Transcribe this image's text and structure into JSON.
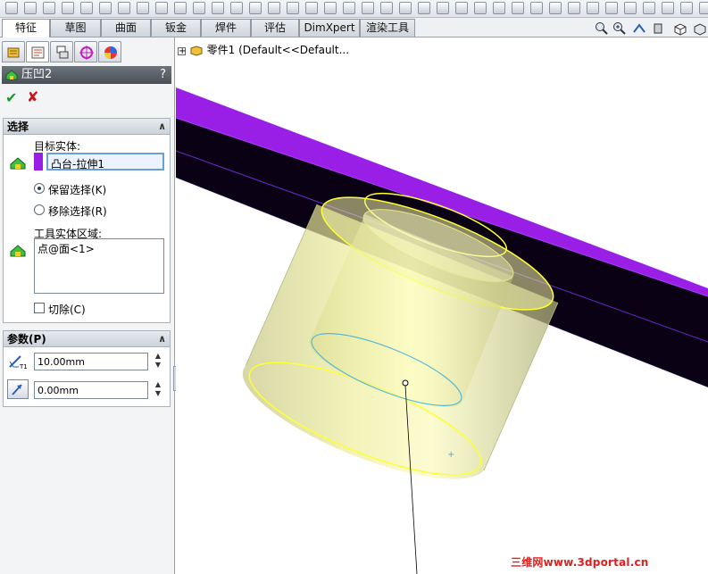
{
  "tabs": [
    {
      "label": "特征",
      "active": true
    },
    {
      "label": "草图"
    },
    {
      "label": "曲面"
    },
    {
      "label": "钣金"
    },
    {
      "label": "焊件"
    },
    {
      "label": "评估"
    },
    {
      "label": "DimXpert"
    },
    {
      "label": "渲染工具"
    }
  ],
  "feature": {
    "title": "压凹2",
    "help": "?",
    "ok": "✔",
    "cancel": "✘"
  },
  "selection": {
    "title": "选择",
    "target_label": "目标实体:",
    "target_value": "凸台-拉伸1",
    "keep_label": "保留选择(K)",
    "remove_label": "移除选择(R)",
    "tool_label": "工具实体区域:",
    "tool_value": "点@面<1>",
    "cut_label": "切除(C)"
  },
  "params": {
    "title": "参数(P)",
    "thickness": "10.00mm",
    "clearance": "0.00mm"
  },
  "tree": {
    "root": "零件1  (Default<<Default..."
  },
  "watermark": "三维网www.3dportal.cn",
  "colors": {
    "accent_purple": "#9a1fe6",
    "body_yellow": "#e8e88a",
    "edge_yellow": "#ffff33",
    "watermark_red": "#e0201c"
  }
}
